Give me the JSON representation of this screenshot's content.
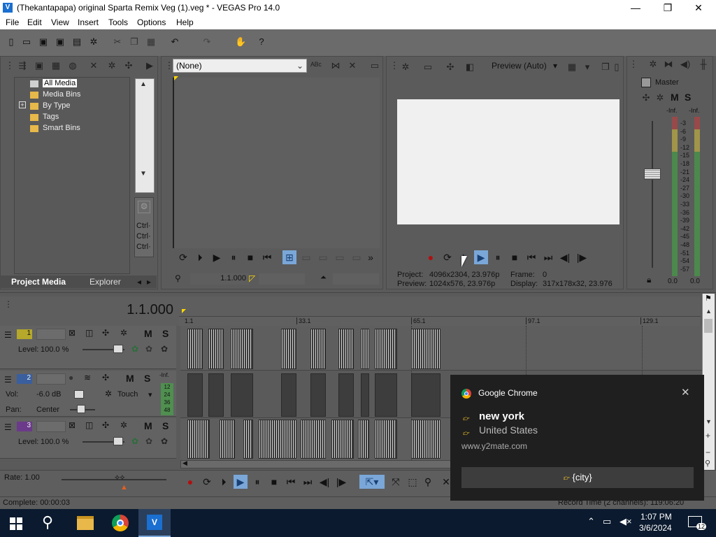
{
  "window": {
    "title": "(Thekantapapa) original Sparta Remix Veg (1).veg * - VEGAS Pro 14.0",
    "minimize": "—",
    "maximize": "❐",
    "close": "✕"
  },
  "menu": [
    "File",
    "Edit",
    "View",
    "Insert",
    "Tools",
    "Options",
    "Help"
  ],
  "media": {
    "tree": [
      "All Media",
      "Media Bins",
      "By Type",
      "Tags",
      "Smart Bins"
    ],
    "expander": "+",
    "tabs": [
      "Project Media",
      "Explorer"
    ],
    "side_text": [
      "Ctrl·",
      "Ctrl·",
      "Ctrl·"
    ]
  },
  "trimmer": {
    "dropdown": "(None)",
    "time": "1.1.000"
  },
  "preview": {
    "mode": "Preview (Auto)",
    "project_label": "Project:",
    "project_value": "4096x2304, 23.976p",
    "preview_label": "Preview:",
    "preview_value": "1024x576, 23.976p",
    "frame_label": "Frame:",
    "frame_value": "0",
    "display_label": "Display:",
    "display_value": "317x178x32, 23.976"
  },
  "mixer": {
    "title": "Master",
    "M": "M",
    "S": "S",
    "inf_l": "-Inf.",
    "inf_r": "-Inf.",
    "scale": [
      "3",
      "6",
      "9",
      "12",
      "15",
      "18",
      "21",
      "24",
      "27",
      "30",
      "33",
      "36",
      "39",
      "42",
      "45",
      "48",
      "51",
      "54",
      "57"
    ],
    "value_l": "0.0",
    "value_r": "0.0"
  },
  "timeline": {
    "time": "1.1.000",
    "markers": [
      "1.1",
      "33.1",
      "65.1",
      "97.1",
      "129.1"
    ]
  },
  "tracks": [
    {
      "num": "1",
      "level_label": "Level:",
      "level": "100.0 %",
      "M": "M",
      "S": "S"
    },
    {
      "num": "2",
      "vol_label": "Vol:",
      "vol": "-6.0 dB",
      "pan_label": "Pan:",
      "pan": "Center",
      "automation": "Touch",
      "M": "M",
      "S": "S",
      "meter_top": "-Inf.",
      "meter": [
        "12",
        "24",
        "36",
        "48"
      ]
    },
    {
      "num": "3",
      "level_label": "Level:",
      "level": "100.0 %",
      "M": "M",
      "S": "S"
    }
  ],
  "bottom": {
    "rate": "Rate: 1.00",
    "complete": "Complete: 00:00:03",
    "record": "Record Time (2 channels): 119:06:20"
  },
  "notification": {
    "app": "Google Chrome",
    "line1": "new york",
    "line2": "United States",
    "site": "www.y2mate.com",
    "button": "{city}",
    "close": "✕"
  },
  "taskbar": {
    "time": "1:07 PM",
    "date": "3/6/2024",
    "badge": "12"
  },
  "colors": {
    "accent": "#1a6fd0",
    "folder": "#e7b84a",
    "play_active": "#7aa7d8"
  }
}
